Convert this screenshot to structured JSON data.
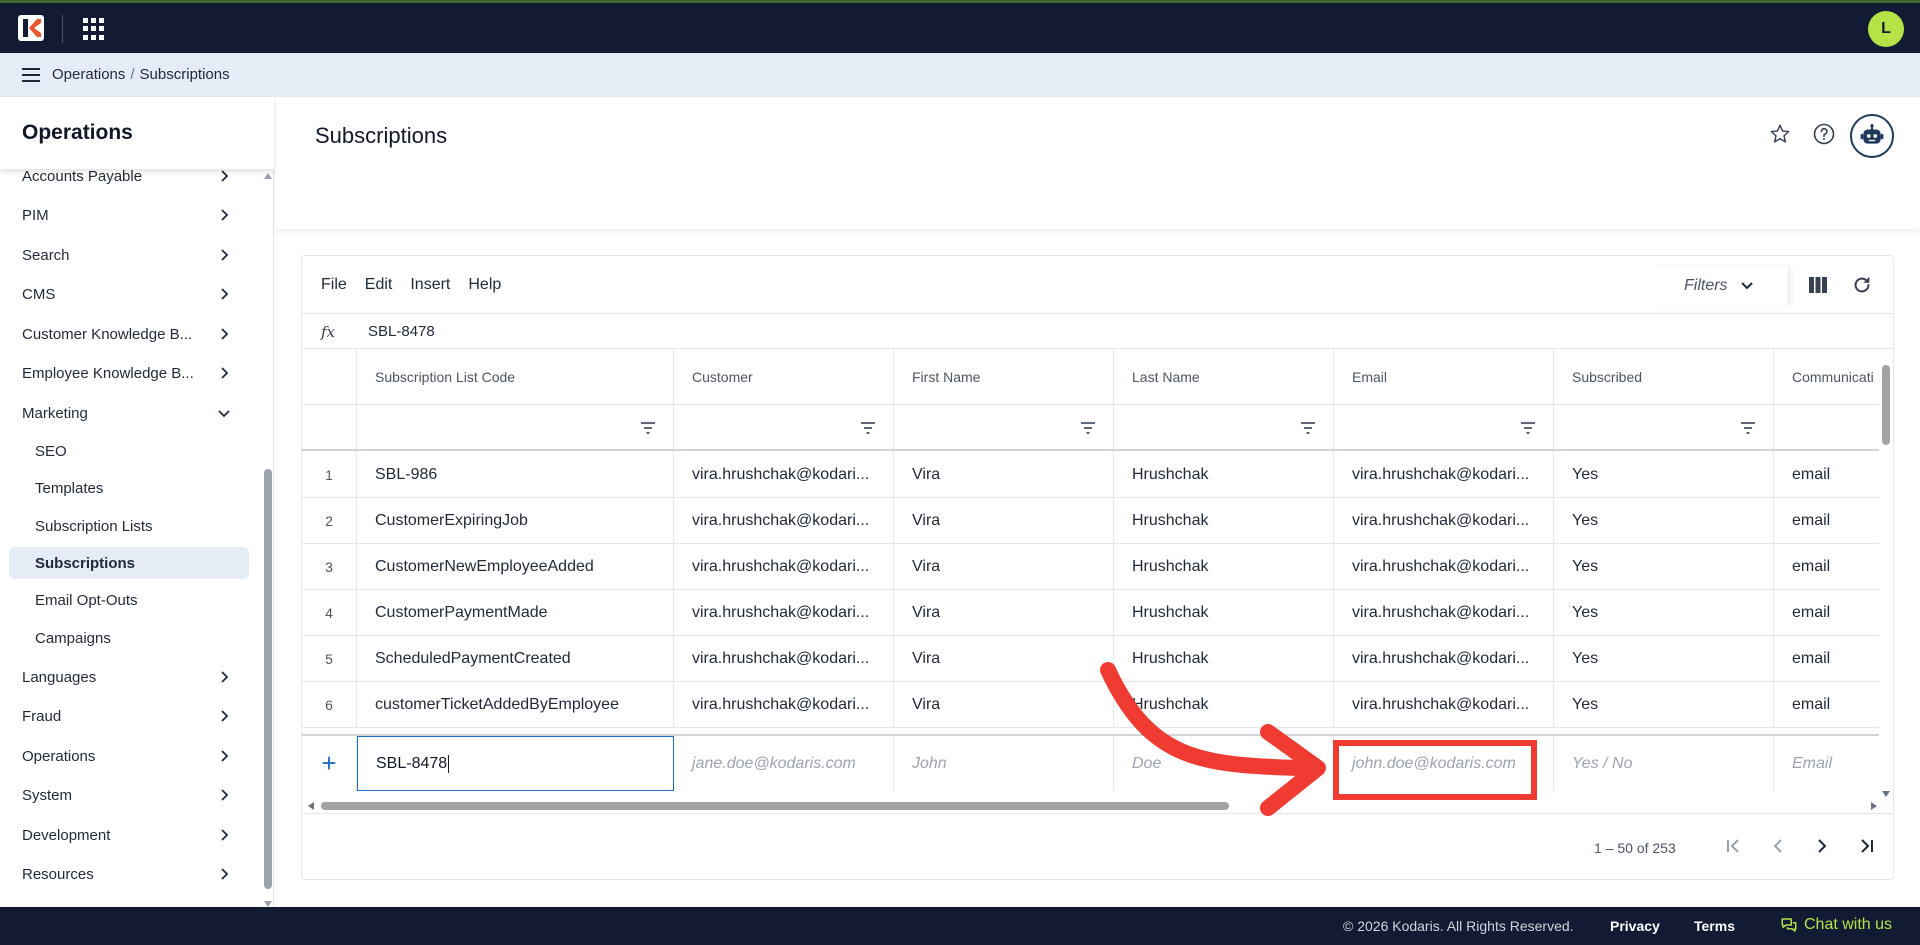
{
  "topbar": {
    "avatar_initial": "L"
  },
  "breadcrumb": {
    "items": [
      "Operations",
      "Subscriptions"
    ],
    "separator": "/"
  },
  "sidebar": {
    "title": "Operations",
    "items": [
      {
        "label": "Accounts Payable",
        "type": "group"
      },
      {
        "label": "PIM",
        "type": "group"
      },
      {
        "label": "Search",
        "type": "group"
      },
      {
        "label": "CMS",
        "type": "group"
      },
      {
        "label": "Customer Knowledge B...",
        "type": "group"
      },
      {
        "label": "Employee Knowledge B...",
        "type": "group"
      },
      {
        "label": "Marketing",
        "type": "group-open"
      },
      {
        "label": "SEO",
        "type": "sub"
      },
      {
        "label": "Templates",
        "type": "sub"
      },
      {
        "label": "Subscription Lists",
        "type": "sub"
      },
      {
        "label": "Subscriptions",
        "type": "sub-active"
      },
      {
        "label": "Email Opt-Outs",
        "type": "sub"
      },
      {
        "label": "Campaigns",
        "type": "sub"
      },
      {
        "label": "Languages",
        "type": "group"
      },
      {
        "label": "Fraud",
        "type": "group"
      },
      {
        "label": "Operations",
        "type": "group"
      },
      {
        "label": "System",
        "type": "group"
      },
      {
        "label": "Development",
        "type": "group"
      },
      {
        "label": "Resources",
        "type": "group"
      }
    ]
  },
  "page": {
    "title": "Subscriptions"
  },
  "toolbar": {
    "menu": [
      "File",
      "Edit",
      "Insert",
      "Help"
    ],
    "filters_label": "Filters"
  },
  "formula_bar": {
    "label": "fx",
    "value": "SBL-8478"
  },
  "table": {
    "columns": [
      "Subscription List Code",
      "Customer",
      "First Name",
      "Last Name",
      "Email",
      "Subscribed",
      "Communicati"
    ],
    "rows": [
      {
        "num": "1",
        "cells": [
          "SBL-986",
          "vira.hrushchak@kodari...",
          "Vira",
          "Hrushchak",
          "vira.hrushchak@kodari...",
          "Yes",
          "email"
        ]
      },
      {
        "num": "2",
        "cells": [
          "CustomerExpiringJob",
          "vira.hrushchak@kodari...",
          "Vira",
          "Hrushchak",
          "vira.hrushchak@kodari...",
          "Yes",
          "email"
        ]
      },
      {
        "num": "3",
        "cells": [
          "CustomerNewEmployeeAdded",
          "vira.hrushchak@kodari...",
          "Vira",
          "Hrushchak",
          "vira.hrushchak@kodari...",
          "Yes",
          "email"
        ]
      },
      {
        "num": "4",
        "cells": [
          "CustomerPaymentMade",
          "vira.hrushchak@kodari...",
          "Vira",
          "Hrushchak",
          "vira.hrushchak@kodari...",
          "Yes",
          "email"
        ]
      },
      {
        "num": "5",
        "cells": [
          "ScheduledPaymentCreated",
          "vira.hrushchak@kodari...",
          "Vira",
          "Hrushchak",
          "vira.hrushchak@kodari...",
          "Yes",
          "email"
        ]
      },
      {
        "num": "6",
        "cells": [
          "customerTicketAddedByEmployee",
          "vira.hrushchak@kodari...",
          "Vira",
          "Hrushchak",
          "vira.hrushchak@kodari...",
          "Yes",
          "email"
        ]
      }
    ],
    "new_row": {
      "add_symbol": "+",
      "value": "SBL-8478",
      "placeholders": [
        "jane.doe@kodaris.com",
        "John",
        "Doe",
        "john.doe@kodaris.com",
        "Yes / No",
        "Email"
      ]
    }
  },
  "pagination": {
    "range_text": "1 – 50 of 253"
  },
  "footer": {
    "copyright": "© 2026 Kodaris. All Rights Reserved.",
    "privacy": "Privacy",
    "terms": "Terms",
    "chat": "Chat with us"
  },
  "colors": {
    "nav": "#131a33",
    "accent": "#b5e347",
    "annotation": "#ef3b32",
    "selection": "#1d6fc4"
  }
}
